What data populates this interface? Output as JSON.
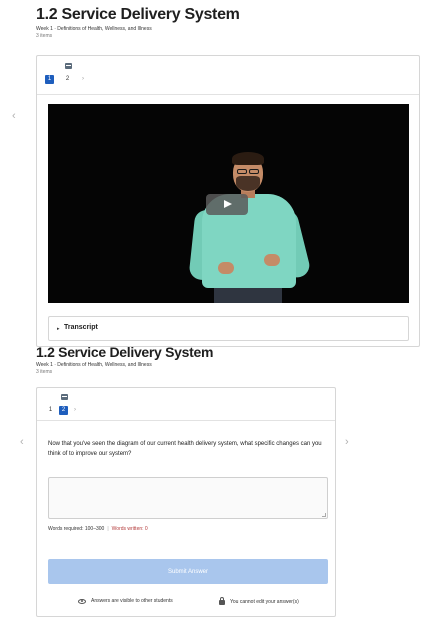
{
  "top": {
    "title": "1.2 Service Delivery System",
    "subtitle": "Week 1 · Definitions of Health, Wellness, and Illness",
    "items_count": "3 items",
    "pages": [
      "1",
      "2"
    ],
    "active_page": "1",
    "transcript_label": "Transcript",
    "chevron_left": "‹"
  },
  "bottom": {
    "title": "1.2 Service Delivery System",
    "subtitle": "Week 1 · Definitions of Health, Wellness, and Illness",
    "items_count": "3 items",
    "pages": [
      "1",
      "2"
    ],
    "active_page": "2",
    "question": "Now that you've seen the diagram of our current health delivery system, what specific changes can you think of to improve our system?",
    "words_required": "Words required: 100–300",
    "words_written": "Words written: 0",
    "submit_label": "Submit Answer",
    "visibility_note": "Answers are visible to other students",
    "edit_note": "You cannot edit your answer(s)",
    "chevron_left": "‹",
    "chevron_right": "›"
  },
  "icons": {
    "page_nav": "chat-bubble-icon",
    "play": "play-icon",
    "transcript_toggle": "caret-right-icon",
    "visibility": "eye-icon",
    "edit": "lock-icon"
  },
  "colors": {
    "accent": "#1e5ebd",
    "submit_disabled": "#a9c6ed",
    "words_written": "#b33a3a",
    "video_bg": "#050505"
  }
}
